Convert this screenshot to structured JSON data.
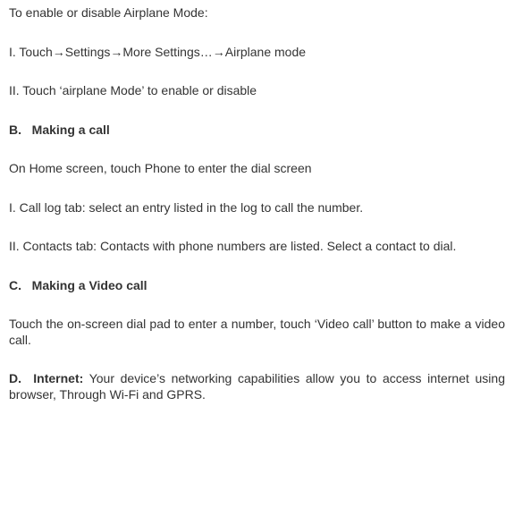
{
  "airplane_intro": "To enable or disable Airplane Mode:",
  "step1_prefix": "I. Touch",
  "arrow": "→",
  "seg_settings": "Settings",
  "seg_more": "More Settings…",
  "seg_airplane": "Airplane mode",
  "step2": "II. Touch ‘airplane Mode’ to enable or disable",
  "section_b": "B.   Making a call",
  "b_desc": "On Home screen, touch Phone to enter the dial screen",
  "b_step1": "I. Call log tab: select an entry listed in the log to call the number.",
  "b_step2": "II. Contacts tab: Contacts with phone numbers are listed. Select a contact to dial.",
  "section_c": "C.   Making a Video call",
  "c_desc": "Touch the on-screen dial pad to enter a number, touch ‘Video call’ button to make a video call.",
  "d_label": "D.  Internet:",
  "d_rest": " Your device’s networking capabilities allow you to access internet using browser, Through Wi-Fi and GPRS."
}
